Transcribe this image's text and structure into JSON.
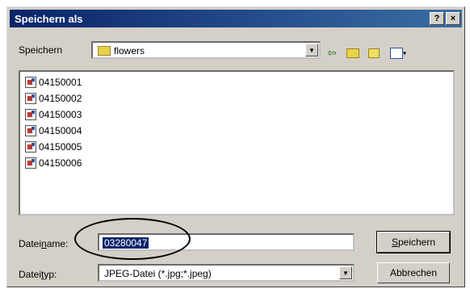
{
  "window": {
    "title": "Speichern als",
    "help_label": "?",
    "close_label": "×"
  },
  "savein": {
    "label": "Speichern",
    "folder": "flowers",
    "folder_icon": "folder-icon"
  },
  "toolbar": {
    "back_icon": "⇦",
    "up_icon": "up-folder-icon",
    "new_folder_icon": "new-folder-icon",
    "view_icon": "view-menu-icon"
  },
  "files": [
    {
      "name": "04150001"
    },
    {
      "name": "04150002"
    },
    {
      "name": "04150003"
    },
    {
      "name": "04150004"
    },
    {
      "name": "04150005"
    },
    {
      "name": "04150006"
    }
  ],
  "filename": {
    "label_pre": "Datei",
    "label_ul": "n",
    "label_post": "ame:",
    "value": "03280047"
  },
  "filetype": {
    "label_pre": "Datei",
    "label_ul": "t",
    "label_post": "yp:",
    "value": "JPEG-Datei (*.jpg;*.jpeg)"
  },
  "buttons": {
    "save_ul": "S",
    "save_rest": "peichern",
    "cancel": "Abbrechen"
  },
  "colors": {
    "titlebar": "#0a246a",
    "selection": "#0a246a",
    "face": "#d4d0c8"
  }
}
